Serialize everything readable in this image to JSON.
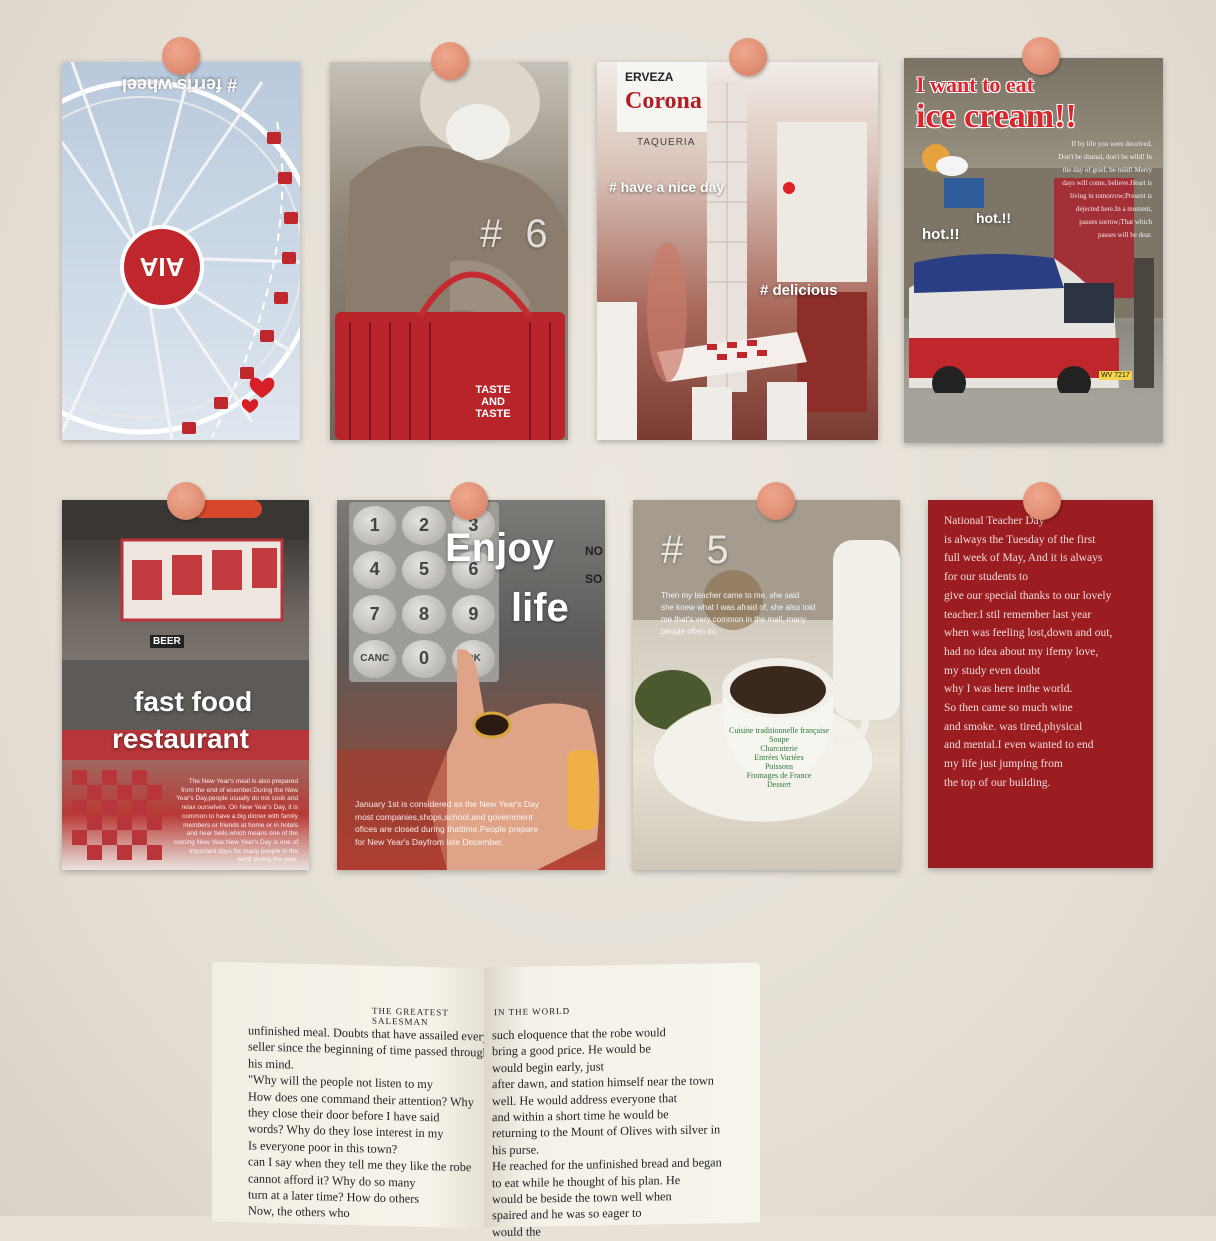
{
  "cards": {
    "ferris": {
      "caption": "# ferris wheel",
      "logo": "AIA"
    },
    "sweater": {
      "caption": "# 6",
      "basket_text": "TASTE AND TASTE"
    },
    "corona": {
      "sign_top": "ERVEZA",
      "sign_brand": "Corona",
      "sign_sub": "TAQUERIA",
      "caption1": "# have a nice day",
      "caption2": "# delicious"
    },
    "icecream": {
      "title1": "I want to eat",
      "title2": "ice cream!!",
      "hot1": "hot.!!",
      "hot2": "hot.!!",
      "small_text": [
        "If by life you were deceived,",
        "Don't be dismal, don't be wild! In",
        "the day of grief, be mild! Merry",
        "days will come, believe.Heart is",
        "living in tomorrow;Present is",
        "dejected here.In a moment,",
        "passes sorrow;That which",
        "passes will be dear."
      ],
      "plate": "WV 7217"
    },
    "fastfood": {
      "sign": "BEER",
      "caption1": "fast food",
      "caption2": "restaurant",
      "small_text": [
        "The New Year's meal is also prepared",
        "from the end of ecember.During the New",
        "Year's Day,people usually do not cook and",
        "relax ourselves. On New Year's Day, it is",
        "common to have a big dinner with family",
        "members or friends at home or in hotels",
        "and hear bells.which means one of the",
        "coming New Year.New Year's Day is one of",
        "important days for many people in the",
        "word during the year."
      ]
    },
    "keypad": {
      "keys": [
        "1",
        "2",
        "3",
        "4",
        "5",
        "6",
        "7",
        "8",
        "9",
        "CANC",
        "0",
        "OK"
      ],
      "caption1": "Enjoy",
      "caption2": "life",
      "side_text": [
        "NO",
        "SO"
      ],
      "small_text": [
        "January 1st is considered as the New Year's Day",
        "most companies,shops,school,and government",
        "ofices are closed during thattime.People prepare",
        "for New Year's Dayfrom late December."
      ]
    },
    "coffee": {
      "caption": "# 5",
      "small_text": [
        "Then my teacher came to me, she said",
        "she knew what I was afraid of, she also told",
        "me that's very common in the mall, many",
        "people often do."
      ],
      "cup_text": [
        "Cuisine traditionnelle française",
        "Soupe",
        "Charcuterie",
        "Entrées Variées",
        "Poissons",
        "Fromages de France",
        "Dessert"
      ]
    },
    "redtext": {
      "lines": [
        "National Teacher Day",
        "is always the Tuesday of the first",
        "full week of May, And it is always",
        "for our students to",
        "give our special thanks to our lovely",
        "teacher.I stil remember last year",
        "when was feeling lost,down and out,",
        "had no idea about my ifemy love,",
        "my study even doubt",
        "why I was here inthe world.",
        "So then came so much wine",
        "and smoke. was tired,physical",
        "and mental.I even wanted to end",
        "my life just jumping from",
        "the top of our building."
      ]
    }
  },
  "book": {
    "left_header": "THE GREATEST SALESMAN",
    "right_header": "IN THE WORLD",
    "left_lines": [
      "unfinished meal. Doubts that have assailed every",
      "seller since the beginning of time passed through",
      "his mind.",
      "\"Why will the people not listen to my",
      "How does one command their attention? Why",
      "they close their door before I have said",
      "words? Why do they lose interest in my",
      "Is everyone poor in this town?",
      "can I say when they tell me they like the robe",
      "cannot afford it? Why do so many",
      "turn at a later time? How do others",
      "Now, the others who"
    ],
    "right_lines": [
      "such eloquence that the robe would",
      "bring a good price. He would be",
      "would begin early, just",
      "after dawn, and station himself near the town",
      "well. He would address everyone that",
      "and within a short time he would be",
      "returning to the Mount of Olives with silver in",
      "his purse.",
      "He reached for the unfinished bread and began",
      "to eat while he thought of his plan. He",
      "would be beside the town well when",
      "spaired and he was so eager to",
      "would the"
    ]
  },
  "colors": {
    "accent_red": "#c0272d",
    "pin": "#e08f74",
    "wall": "#e7e1d8"
  }
}
